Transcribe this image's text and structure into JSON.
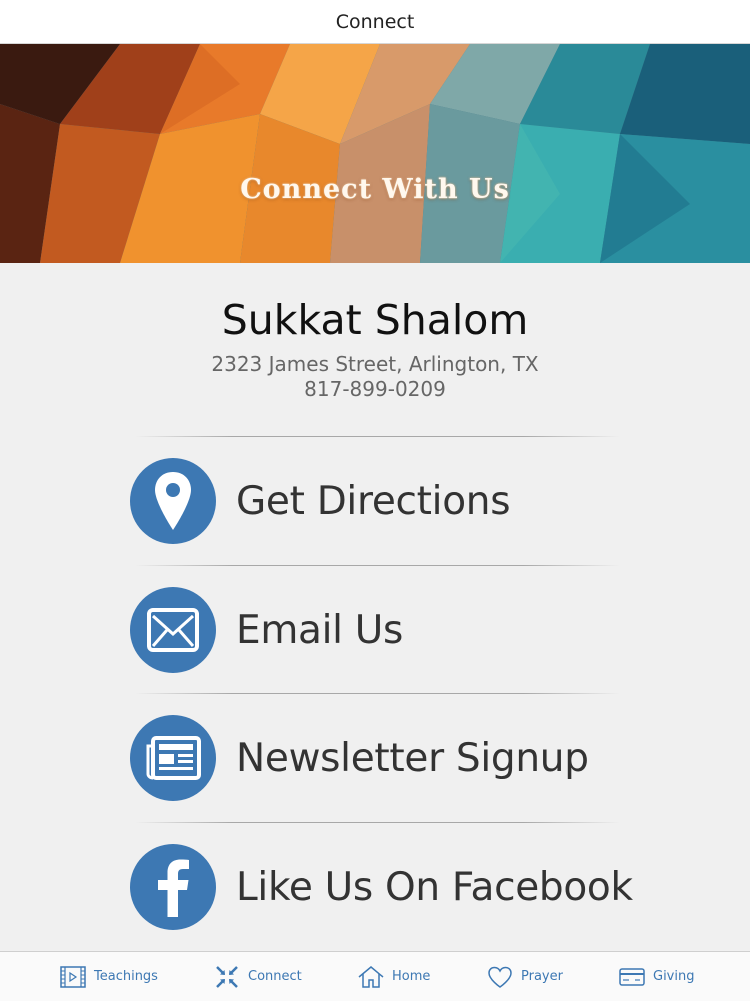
{
  "nav": {
    "title": "Connect"
  },
  "banner": {
    "title": "Connect With Us"
  },
  "organization": {
    "name": "Sukkat Shalom",
    "address": "2323 James Street, Arlington, TX",
    "phone": "817-899-0209"
  },
  "actions": [
    {
      "label": "Get Directions",
      "icon": "map-pin-icon"
    },
    {
      "label": "Email Us",
      "icon": "envelope-icon"
    },
    {
      "label": "Newsletter Signup",
      "icon": "newspaper-icon"
    },
    {
      "label": "Like Us On Facebook",
      "icon": "facebook-icon"
    }
  ],
  "tabbar": {
    "items": [
      {
        "label": "Teachings",
        "icon": "film-icon"
      },
      {
        "label": "Connect",
        "icon": "connect-arrows-icon",
        "selected": true
      },
      {
        "label": "Home",
        "icon": "home-icon"
      },
      {
        "label": "Prayer",
        "icon": "heart-icon"
      },
      {
        "label": "Giving",
        "icon": "credit-card-icon"
      }
    ]
  },
  "colors": {
    "accent": "#3d78b3",
    "background": "#f0f0f0",
    "text_secondary": "#666666"
  }
}
